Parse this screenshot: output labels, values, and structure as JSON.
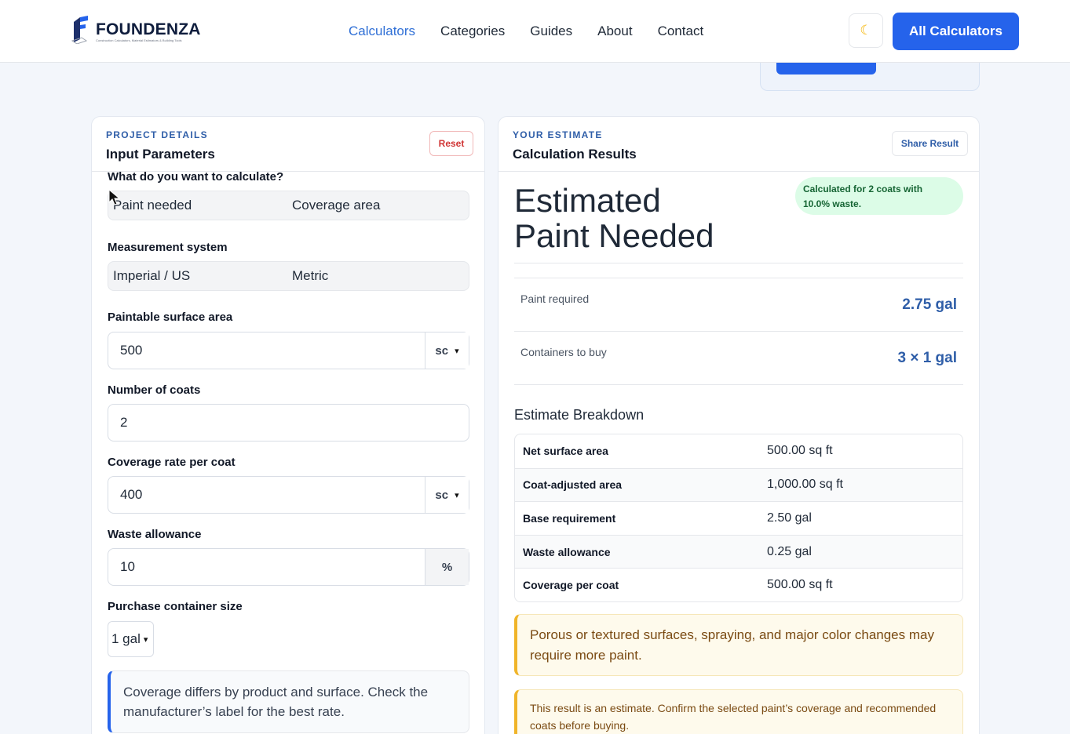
{
  "header": {
    "logo_title": "FOUNDENZA",
    "logo_tagline": "Construction Calculators, Material Estimators & Building Tools",
    "nav": [
      "Calculators",
      "Categories",
      "Guides",
      "About",
      "Contact"
    ],
    "active_nav": "Calculators",
    "theme_icon": "moon-icon",
    "cta_label": "All Calculators"
  },
  "inputs_panel": {
    "eyebrow": "PROJECT DETAILS",
    "title": "Input Parameters",
    "reset_label": "Reset",
    "calc_question": "What do you want to calculate?",
    "calc_options": [
      "Paint needed",
      "Coverage area"
    ],
    "measurement_label": "Measurement system",
    "measurement_options": [
      "Imperial / US",
      "Metric"
    ],
    "surface_label": "Paintable surface area",
    "surface_value": "500",
    "surface_unit": "sc",
    "coats_label": "Number of coats",
    "coats_value": "2",
    "coverage_label": "Coverage rate per coat",
    "coverage_value": "400",
    "coverage_unit": "sc",
    "waste_label": "Waste allowance",
    "waste_value": "10",
    "waste_unit": "%",
    "container_label": "Purchase container size",
    "container_value": "1 gal",
    "note": "Coverage differs by product and surface. Check the manufacturer’s label for the best rate."
  },
  "results_panel": {
    "eyebrow": "YOUR ESTIMATE",
    "title": "Calculation Results",
    "share_label": "Share Result",
    "heading_line1": "Estimated",
    "heading_line2": "Paint Needed",
    "pill_line1": "Calculated for 2 coats with",
    "pill_line2": "10.0% waste.",
    "results": [
      {
        "label": "Paint required",
        "value": "2.75 gal"
      },
      {
        "label": "Containers to buy",
        "value": "3 × 1 gal"
      }
    ],
    "breakdown_title": "Estimate Breakdown",
    "breakdown": [
      {
        "k": "Net surface area",
        "v": "500.00 sq ft"
      },
      {
        "k": "Coat-adjusted area",
        "v": "1,000.00 sq ft"
      },
      {
        "k": "Base requirement",
        "v": "2.50 gal"
      },
      {
        "k": "Waste allowance",
        "v": "0.25 gal"
      },
      {
        "k": "Coverage per coat",
        "v": "500.00 sq ft"
      }
    ],
    "warning": "Porous or textured surfaces, spraying, and major color changes may require more paint.",
    "disclaimer": "This result is an estimate. Confirm the selected paint’s coverage and recommended coats before buying."
  },
  "colors": {
    "accent": "#2563eb",
    "eyebrow": "#2f5ea8",
    "reset": "#d03535",
    "pill_bg": "#dcfce7",
    "warning_border": "#f0b429"
  }
}
